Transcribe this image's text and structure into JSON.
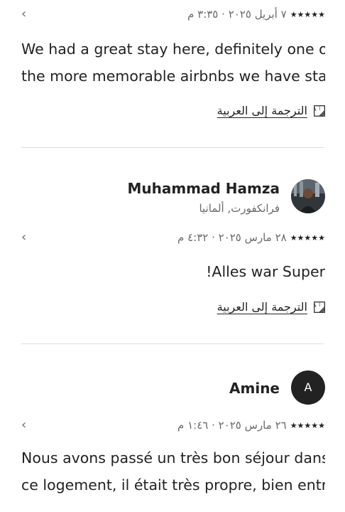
{
  "reviews": [
    {
      "meta_text": "٧ أبريل ٢٠٢٥ · ٣:٣٥ م",
      "stars": "★★★★★",
      "body_lines": [
        "We had a great stay here, definitely one of",
        "the more memorable airbnbs we have sta..."
      ],
      "translate_label": "الترجمة إلى العربية"
    },
    {
      "user_name": "Muhammad Hamza",
      "location": "فرانكفورت, ألمانيا",
      "meta_text": "٢٨ مارس ٢٠٢٥ · ٤:٣٢ م",
      "stars": "★★★★★",
      "body_lines": [
        "!Alles war Super"
      ],
      "translate_label": "الترجمة إلى العربية"
    },
    {
      "user_name": "Amine",
      "avatar_initial": "A",
      "meta_text": "٢٦ مارس ٢٠٢٥ · ١:٤٦ م",
      "stars": "★★★★★",
      "body_lines": [
        "Nous avons passé un très bon séjour dans",
        "ce logement, il était très propre, bien entr..."
      ]
    }
  ],
  "icons": {
    "chevron": "chevron-left-icon",
    "translate": "translate-icon"
  }
}
